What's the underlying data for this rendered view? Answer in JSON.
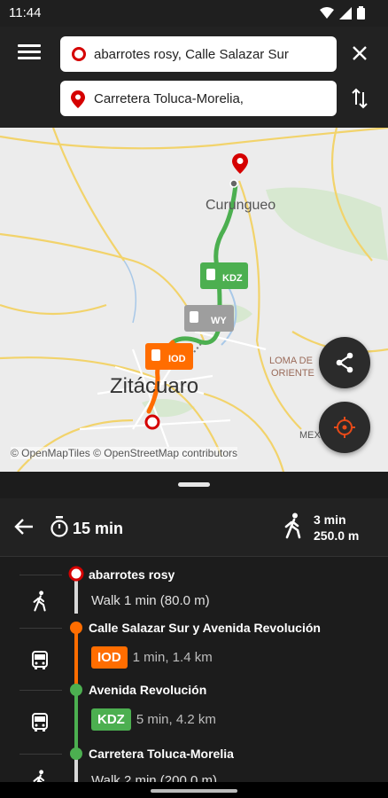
{
  "status_bar": {
    "time": "11:44"
  },
  "search": {
    "origin": "abarrotes rosy, Calle Salazar Sur",
    "destination": "Carretera Toluca-Morelia,"
  },
  "map": {
    "labels": {
      "town_north": "Curungueo",
      "city": "Zitácuaro",
      "district": "LOMA DE",
      "district2": "ORIENTE",
      "highway": "MEX"
    },
    "route_badges": {
      "kdz": "KDZ",
      "iod": "IOD",
      "gray": "WY"
    },
    "attribution": "© OpenMapTiles © OpenStreetMap contributors",
    "colors": {
      "route_green": "#4caf50",
      "route_orange": "#ff6d00",
      "pin_red": "#d50000"
    }
  },
  "summary": {
    "duration": "15 min",
    "walk_time": "3 min",
    "walk_distance": "250.0 m"
  },
  "itinerary": {
    "stops": [
      "abarrotes rosy",
      "Calle Salazar Sur y Avenida Revolución",
      "Avenida Revolución",
      "Carretera Toluca-Morelia"
    ],
    "walk1": "Walk 1 min (80.0 m)",
    "ride1": {
      "line": "IOD",
      "detail": "1 min, 1.4 km",
      "color": "#ff6d00"
    },
    "ride2": {
      "line": "KDZ",
      "detail": "5 min, 4.2 km",
      "color": "#4caf50"
    },
    "walk2": "Walk 2 min (200.0 m)"
  },
  "icons": [
    "wifi-icon",
    "signal-icon",
    "battery-icon",
    "menu-icon",
    "close-icon",
    "swap-icon",
    "share-icon",
    "locate-icon",
    "back-arrow-icon",
    "timer-icon",
    "walk-icon",
    "bus-icon"
  ]
}
